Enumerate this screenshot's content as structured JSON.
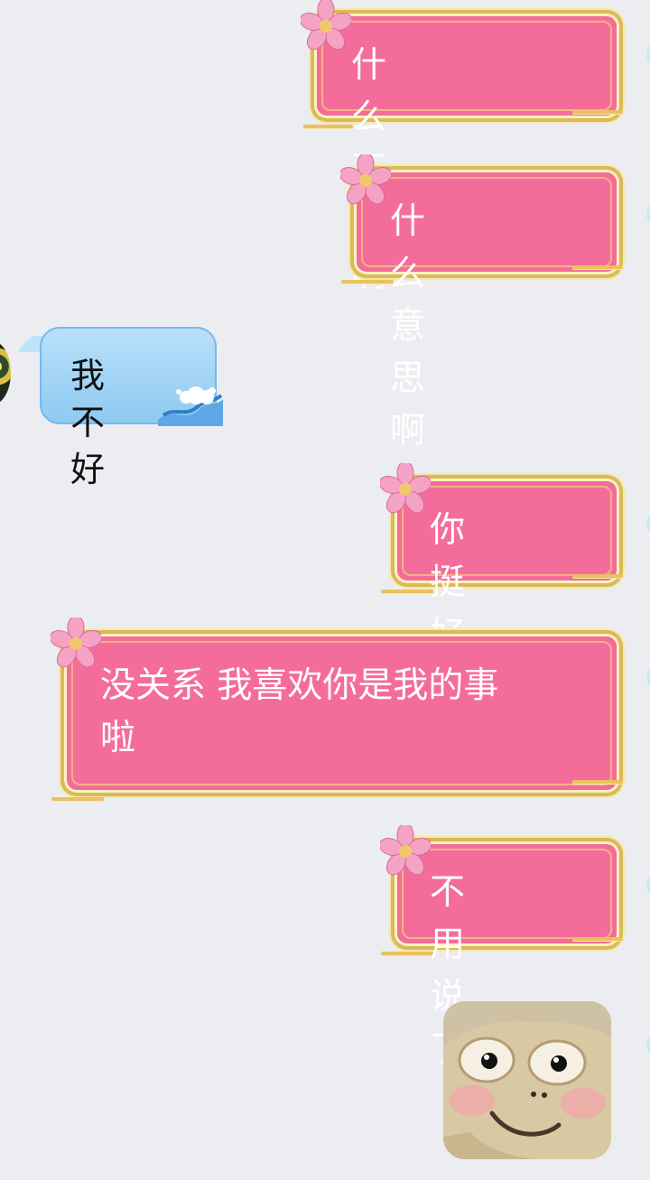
{
  "chat": {
    "messages": [
      {
        "sender": "me",
        "text": "什么不好啊?"
      },
      {
        "sender": "me",
        "text": "什么意思啊"
      },
      {
        "sender": "other",
        "text": "我不好"
      },
      {
        "sender": "me",
        "text": "你挺好的"
      },
      {
        "sender": "me",
        "text": "没关系 我喜欢你是我的事\n啦"
      },
      {
        "sender": "me",
        "text": "不用说了"
      },
      {
        "sender": "me",
        "text": "",
        "sticker": "goat-face-sticker"
      }
    ]
  },
  "theme": {
    "background": "#ecedf1",
    "pink_bubble": "#f46d9a",
    "gold_border": "#d9ba5a",
    "blue_bubble": "#8fcaf1",
    "text_white": "#ffffff",
    "text_dark": "#111111"
  }
}
